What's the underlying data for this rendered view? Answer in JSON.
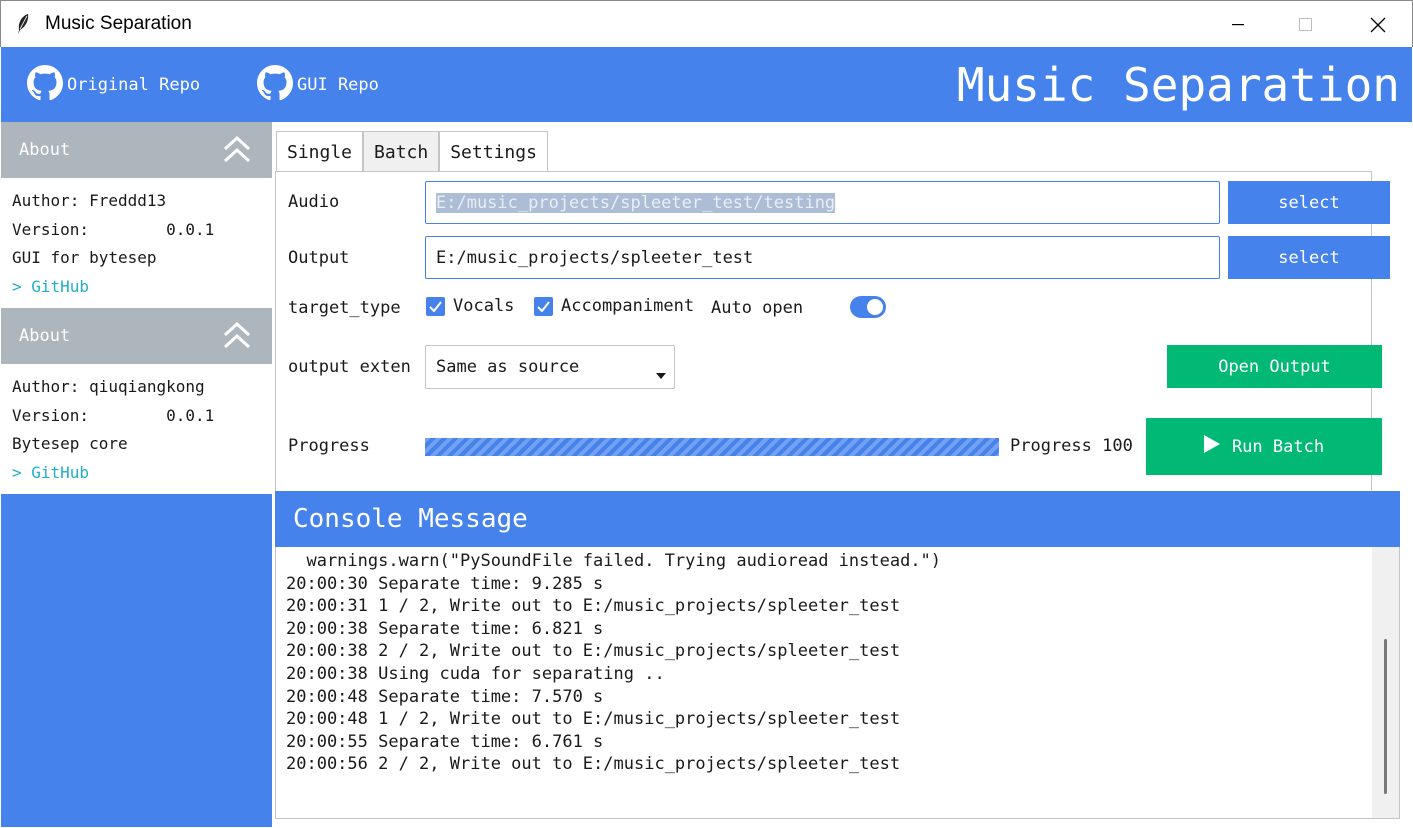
{
  "window": {
    "title": "Music Separation",
    "icon": "feather-icon"
  },
  "header": {
    "links": [
      {
        "label": "Original Repo",
        "icon": "github-icon"
      },
      {
        "label": "GUI Repo",
        "icon": "github-icon"
      }
    ],
    "title": "Music Separation"
  },
  "sidebar": {
    "sections": [
      {
        "heading": "About",
        "author": "Author: Freddd13",
        "version": "Version:        0.0.1",
        "desc": "GUI for bytesep",
        "link": "> GitHub"
      },
      {
        "heading": "About",
        "author": "Author: qiuqiangkong",
        "version": "Version:        0.0.1",
        "desc": "Bytesep core",
        "link": "> GitHub"
      }
    ]
  },
  "tabs": [
    "Single",
    "Batch",
    "Settings"
  ],
  "active_tab": "Batch",
  "form": {
    "audio_label": "Audio",
    "audio_value": "E:/music_projects/spleeter_test/testing",
    "output_label": "Output",
    "output_value": "E:/music_projects/spleeter_test",
    "select_label": "select",
    "target_label": "target_type",
    "vocals_label": "Vocals",
    "vocals_checked": true,
    "accompaniment_label": "Accompaniment",
    "accompaniment_checked": true,
    "auto_open_label": "Auto open",
    "auto_open_on": true,
    "ext_label": "output exten",
    "ext_value": "Same as source",
    "open_output_label": "Open Output",
    "progress_label": "Progress",
    "progress_text": "Progress 100",
    "progress_value": 100,
    "run_label": "Run Batch"
  },
  "console": {
    "title": "Console Message",
    "cut_line": "  warnings.warn(\"PySoundFile failed. Trying audioread instead.\")",
    "lines": [
      "  warnings.warn(\"PySoundFile failed. Trying audioread instead.\")",
      "20:00:30 Separate time: 9.285 s",
      "20:00:31 1 / 2, Write out to E:/music_projects/spleeter_test",
      "20:00:38 Separate time: 6.821 s",
      "20:00:38 2 / 2, Write out to E:/music_projects/spleeter_test",
      "20:00:38 Using cuda for separating ..",
      "20:00:48 Separate time: 7.570 s",
      "20:00:48 1 / 2, Write out to E:/music_projects/spleeter_test",
      "20:00:55 Separate time: 6.761 s",
      "20:00:56 2 / 2, Write out to E:/music_projects/spleeter_test"
    ]
  },
  "colors": {
    "primary": "#4582ec",
    "success": "#02b875",
    "secondary": "#adb5bd",
    "link": "#1fb0c9"
  }
}
